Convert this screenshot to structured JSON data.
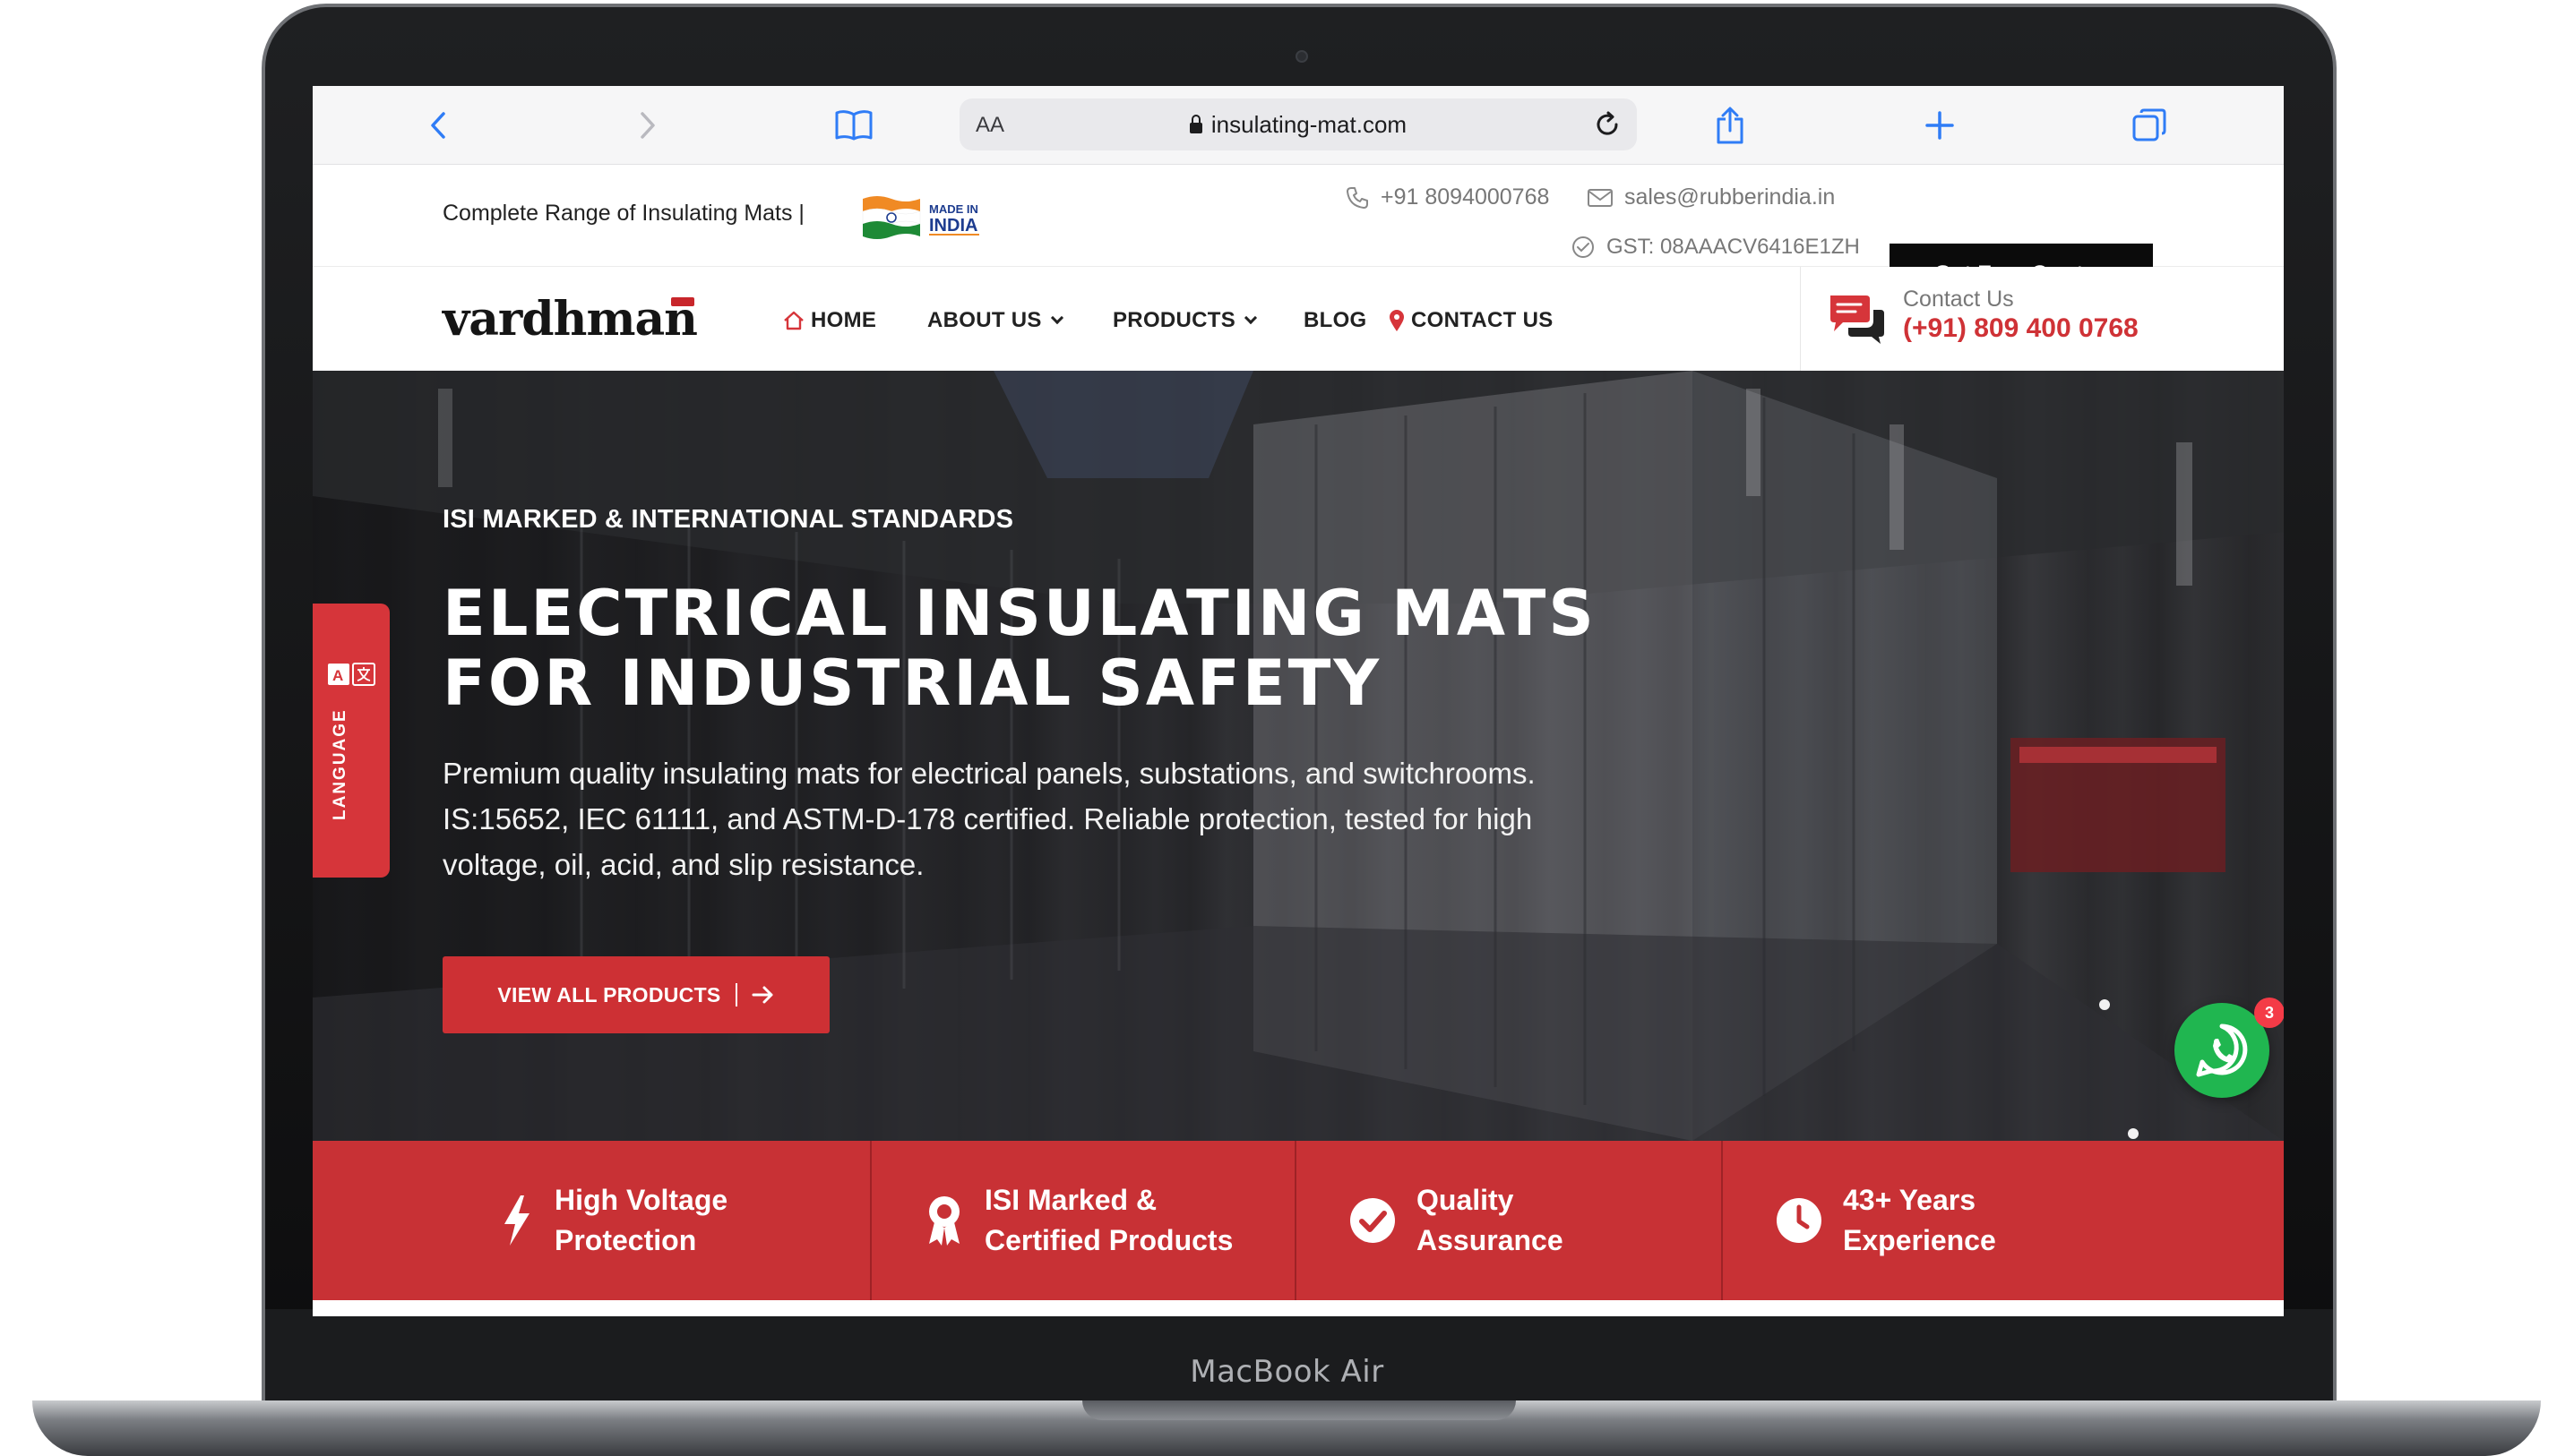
{
  "browser": {
    "aa_label": "AA",
    "url": "insulating-mat.com"
  },
  "topbar": {
    "tagline": "Complete Range of Insulating Mats |",
    "badge_line1": "MADE IN",
    "badge_line2": "INDIA",
    "phone": "+91 8094000768",
    "email": "sales@rubberindia.in",
    "gst": "GST: 08AAACV6416E1ZH",
    "quote_button": "Get Free Quotes"
  },
  "nav": {
    "logo": "vardhman",
    "items": [
      {
        "label": "HOME",
        "icon": "home-icon"
      },
      {
        "label": "ABOUT US",
        "has_dropdown": true
      },
      {
        "label": "PRODUCTS",
        "has_dropdown": true
      },
      {
        "label": "BLOG"
      },
      {
        "label": "CONTACT US",
        "icon": "map-pin-icon"
      }
    ],
    "contact_label": "Contact Us",
    "contact_phone": "(+91) 809 400 0768"
  },
  "hero": {
    "eyebrow": "ISI MARKED & INTERNATIONAL STANDARDS",
    "title_line1": "ELECTRICAL INSULATING MATS",
    "title_line2": "FOR INDUSTRIAL SAFETY",
    "description": "Premium quality insulating mats for electrical panels, substations, and switchrooms. IS:15652, IEC 61111, and ASTM-D-178 certified. Reliable protection, tested for high voltage, oil, acid, and slip resistance.",
    "cta": "VIEW ALL PRODUCTS"
  },
  "language_tab": "LANGUAGE",
  "whatsapp_badge": "3",
  "features": [
    {
      "line1": "High Voltage",
      "line2": "Protection",
      "icon": "lightning-icon"
    },
    {
      "line1": "ISI Marked &",
      "line2": "Certified Products",
      "icon": "award-ribbon-icon"
    },
    {
      "line1": "Quality",
      "line2": "Assurance",
      "icon": "check-circle-icon"
    },
    {
      "line1": "43+ Years",
      "line2": "Experience",
      "icon": "clock-icon"
    }
  ],
  "device_label": "MacBook Air",
  "colors": {
    "brand_red": "#c83135",
    "cta_red": "#cd3034",
    "whatsapp_green": "#20b650",
    "dark": "#0b0b0b"
  }
}
